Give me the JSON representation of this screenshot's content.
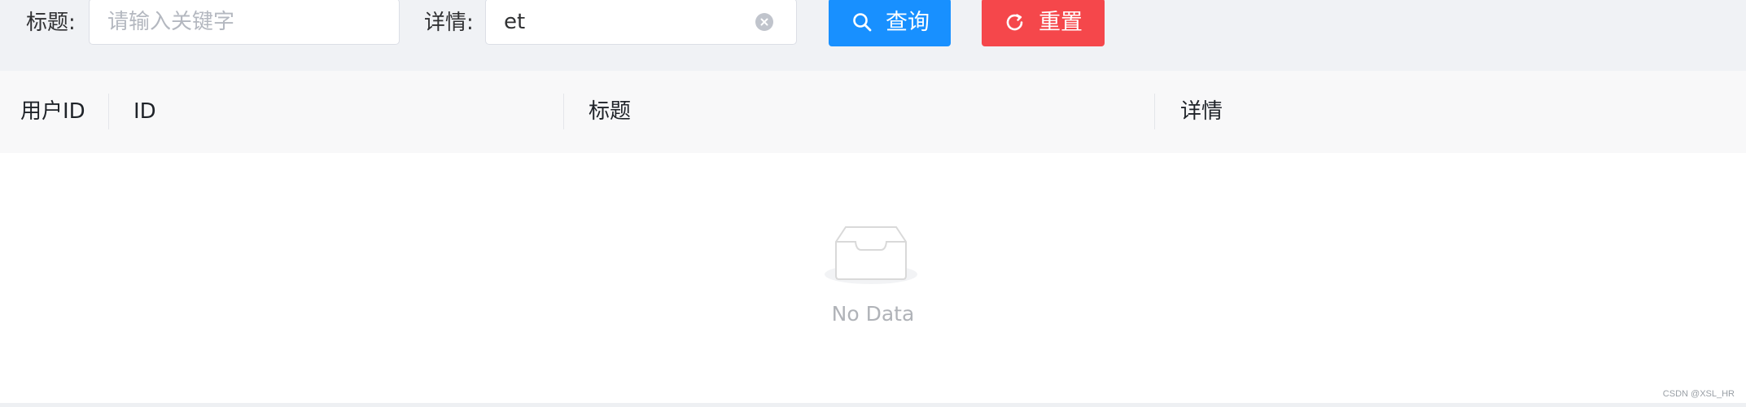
{
  "search": {
    "title_label": "标题:",
    "title_placeholder": "请输入关键字",
    "detail_label": "详情:",
    "detail_value": "et",
    "search_button": "查询",
    "reset_button": "重置"
  },
  "table": {
    "columns": [
      "用户ID",
      "ID",
      "标题",
      "详情"
    ],
    "empty_text": "No Data"
  },
  "watermark": "CSDN @XSL_HR",
  "colors": {
    "primary": "#1890ff",
    "danger": "#f5474b"
  },
  "icons": {
    "search": "search-icon",
    "reset": "refresh-icon",
    "clear": "clear-icon",
    "empty": "empty-box-icon"
  }
}
